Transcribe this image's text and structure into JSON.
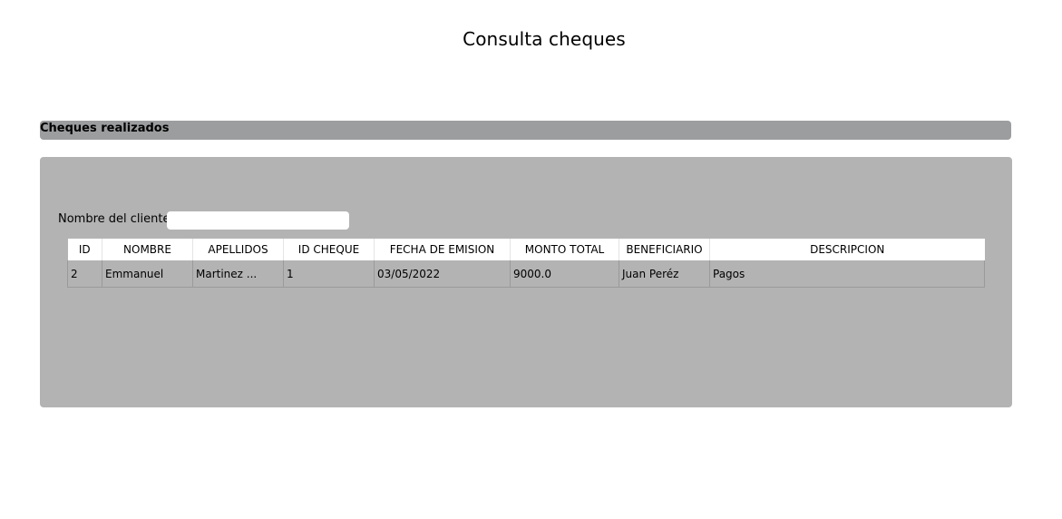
{
  "page": {
    "title": "Consulta cheques"
  },
  "section": {
    "label": "Cheques realizados"
  },
  "filter": {
    "label": "Nombre del cliente:",
    "value": "",
    "placeholder": ""
  },
  "table": {
    "headers": [
      "ID",
      "NOMBRE",
      "APELLIDOS",
      "ID CHEQUE",
      "FECHA DE EMISION",
      "MONTO TOTAL",
      "BENEFICIARIO",
      "DESCRIPCION"
    ],
    "rows": [
      [
        "2",
        "Emmanuel",
        "Martinez ...",
        "1",
        "03/05/2022",
        "9000.0",
        "Juan Peréz",
        "Pagos"
      ]
    ]
  },
  "colors": {
    "section_bar": "#9c9d9f",
    "panel": "#b3b3b3",
    "header_bg": "#ffffff"
  }
}
